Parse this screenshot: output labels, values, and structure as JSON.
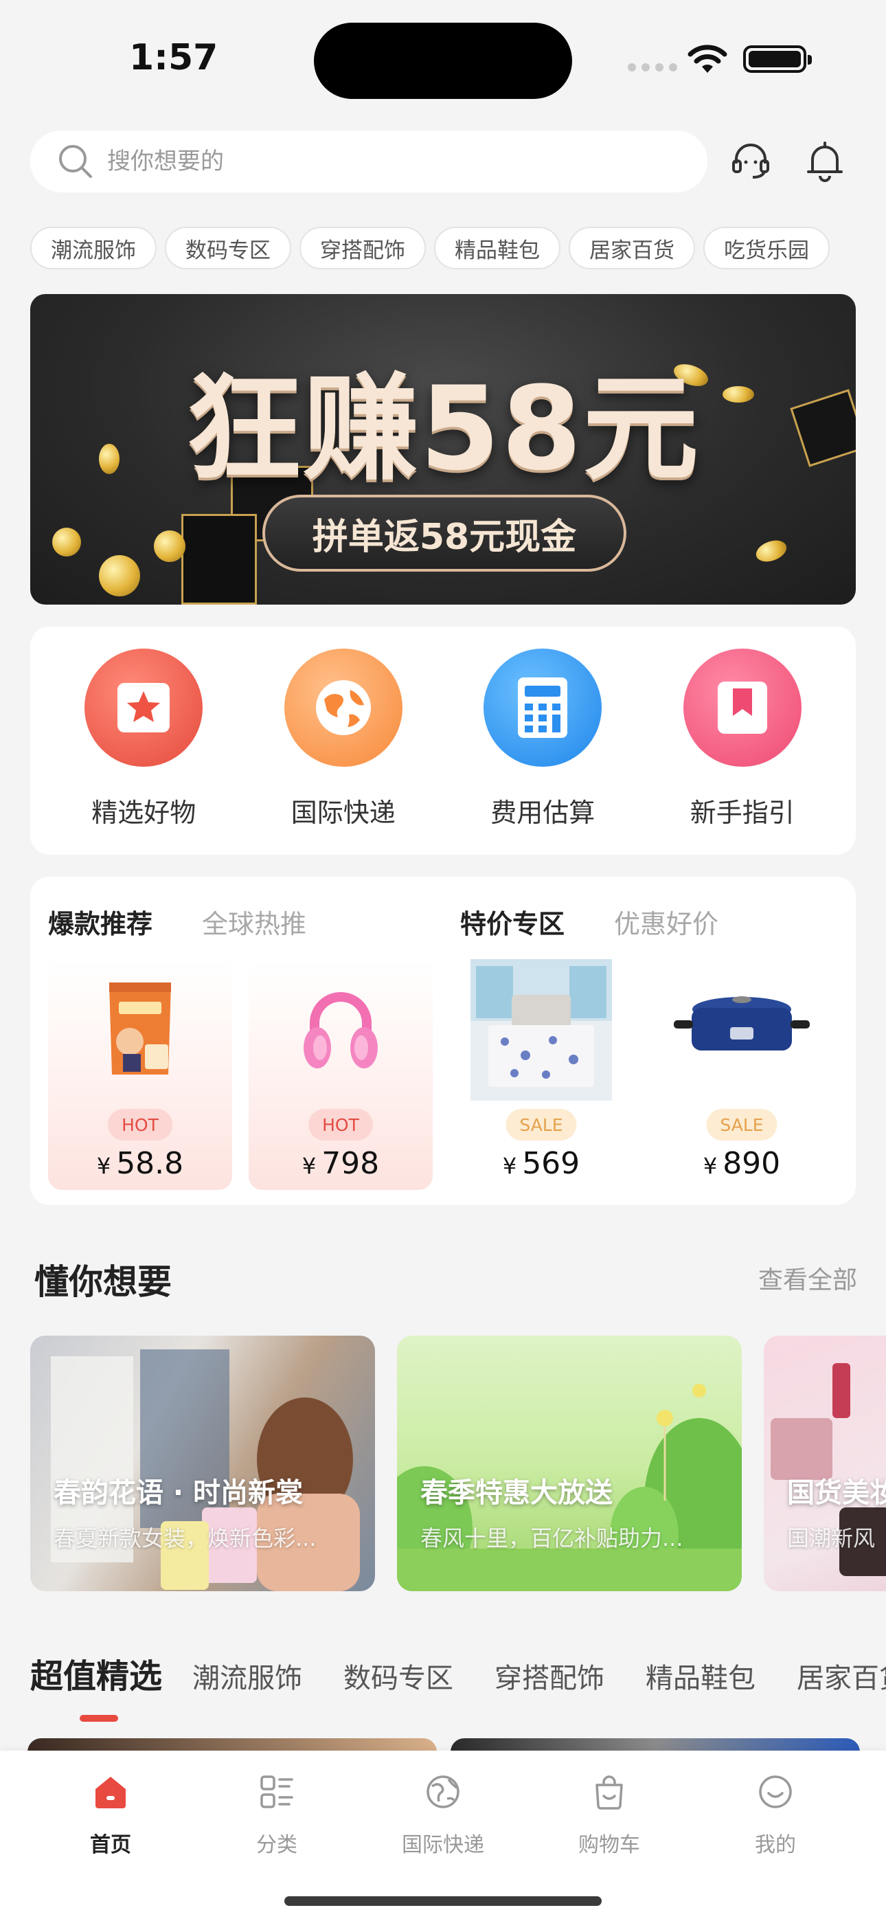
{
  "status_bar": {
    "time": "1:57"
  },
  "search": {
    "placeholder": "搜你想要的"
  },
  "header_icons": {
    "service": "headset-icon",
    "notifications": "bell-icon"
  },
  "category_chips": [
    "潮流服饰",
    "数码专区",
    "穿搭配饰",
    "精品鞋包",
    "居家百货",
    "吃货乐园"
  ],
  "banner": {
    "title": "狂赚58元",
    "subtitle": "拼单返58元现金"
  },
  "quick_actions": [
    {
      "label": "精选好物",
      "icon": "star-icon",
      "color": "#ef5b4c"
    },
    {
      "label": "国际快递",
      "icon": "globe-icon",
      "color": "#fb9a4c"
    },
    {
      "label": "费用估算",
      "icon": "calculator-icon",
      "color": "#2e95f0"
    },
    {
      "label": "新手指引",
      "icon": "bookmark-icon",
      "color": "#f2557a"
    }
  ],
  "promo": {
    "left": {
      "title": "爆款推荐",
      "subtitle": "全球热推",
      "products": [
        {
          "badge": "HOT",
          "currency": "¥",
          "price": "58.8",
          "image": "snack-bag"
        },
        {
          "badge": "HOT",
          "currency": "¥",
          "price": "798",
          "image": "pink-headphones"
        }
      ]
    },
    "right": {
      "title": "特价专区",
      "subtitle": "优惠好价",
      "products": [
        {
          "badge": "SALE",
          "currency": "¥",
          "price": "569",
          "image": "bedding-set"
        },
        {
          "badge": "SALE",
          "currency": "¥",
          "price": "890",
          "image": "electric-grill-pot"
        }
      ]
    }
  },
  "section": {
    "title": "懂你想要",
    "view_all": "查看全部"
  },
  "carousel": [
    {
      "title": "春韵花语 · 时尚新裳",
      "subtitle": "春夏新款女装，焕新色彩..."
    },
    {
      "title": "春季特惠大放送",
      "subtitle": "春风十里，百亿补贴助力..."
    },
    {
      "title": "国货美妆",
      "subtitle": "国潮新风"
    }
  ],
  "value_picks": {
    "title": "超值精选",
    "tabs": [
      "潮流服饰",
      "数码专区",
      "穿搭配饰",
      "精品鞋包",
      "居家百货"
    ]
  },
  "tabbar": [
    {
      "label": "首页",
      "icon": "home-icon",
      "active": true
    },
    {
      "label": "分类",
      "icon": "category-icon",
      "active": false
    },
    {
      "label": "国际快递",
      "icon": "globe-icon",
      "active": false
    },
    {
      "label": "购物车",
      "icon": "shopping-bag-icon",
      "active": false
    },
    {
      "label": "我的",
      "icon": "smile-icon",
      "active": false
    }
  ],
  "colors": {
    "accent": "#e84a40",
    "background": "#f4f4f5"
  }
}
